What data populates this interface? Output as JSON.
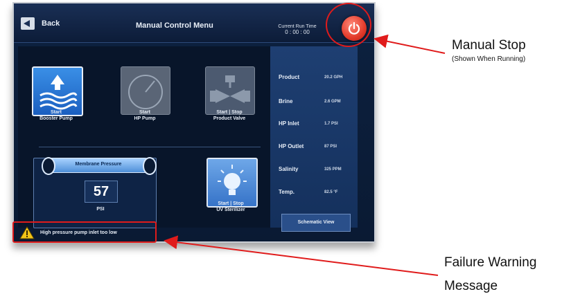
{
  "header": {
    "back_label": "Back",
    "title": "Manual Control Menu",
    "runtime_label": "Current Run Time",
    "runtime_value": "0 : 00 : 00"
  },
  "controls": {
    "booster_label": "Start\nBooster Pump",
    "hp_label": "Start\nHP Pump",
    "valve_label": "Start | Stop\nProduct Valve",
    "uv_label": "Start | Stop\nUV Sterilizer"
  },
  "membrane": {
    "label": "Membrane Pressure",
    "value": "57",
    "unit": "PSI"
  },
  "stats": [
    {
      "label": "Product",
      "value": "20.2 GPH"
    },
    {
      "label": "Brine",
      "value": "2.6 GPM"
    },
    {
      "label": "HP Inlet",
      "value": "1.7 PSI"
    },
    {
      "label": "HP Outlet",
      "value": "87 PSI"
    },
    {
      "label": "Salinity",
      "value": "325 PPM"
    },
    {
      "label": "Temp.",
      "value": "82.5 °F"
    }
  ],
  "schematic_label": "Schematic View",
  "warning": {
    "text": "High pressure pump inlet too low"
  },
  "annotations": {
    "stop_title": "Manual Stop",
    "stop_sub": "(Shown When Running)",
    "fail_line1": "Failure Warning",
    "fail_line2": "Message"
  },
  "colors": {
    "callout": "#e01b1b",
    "stop_button": "#e23a2a",
    "screen_bg": "#0d2140"
  }
}
